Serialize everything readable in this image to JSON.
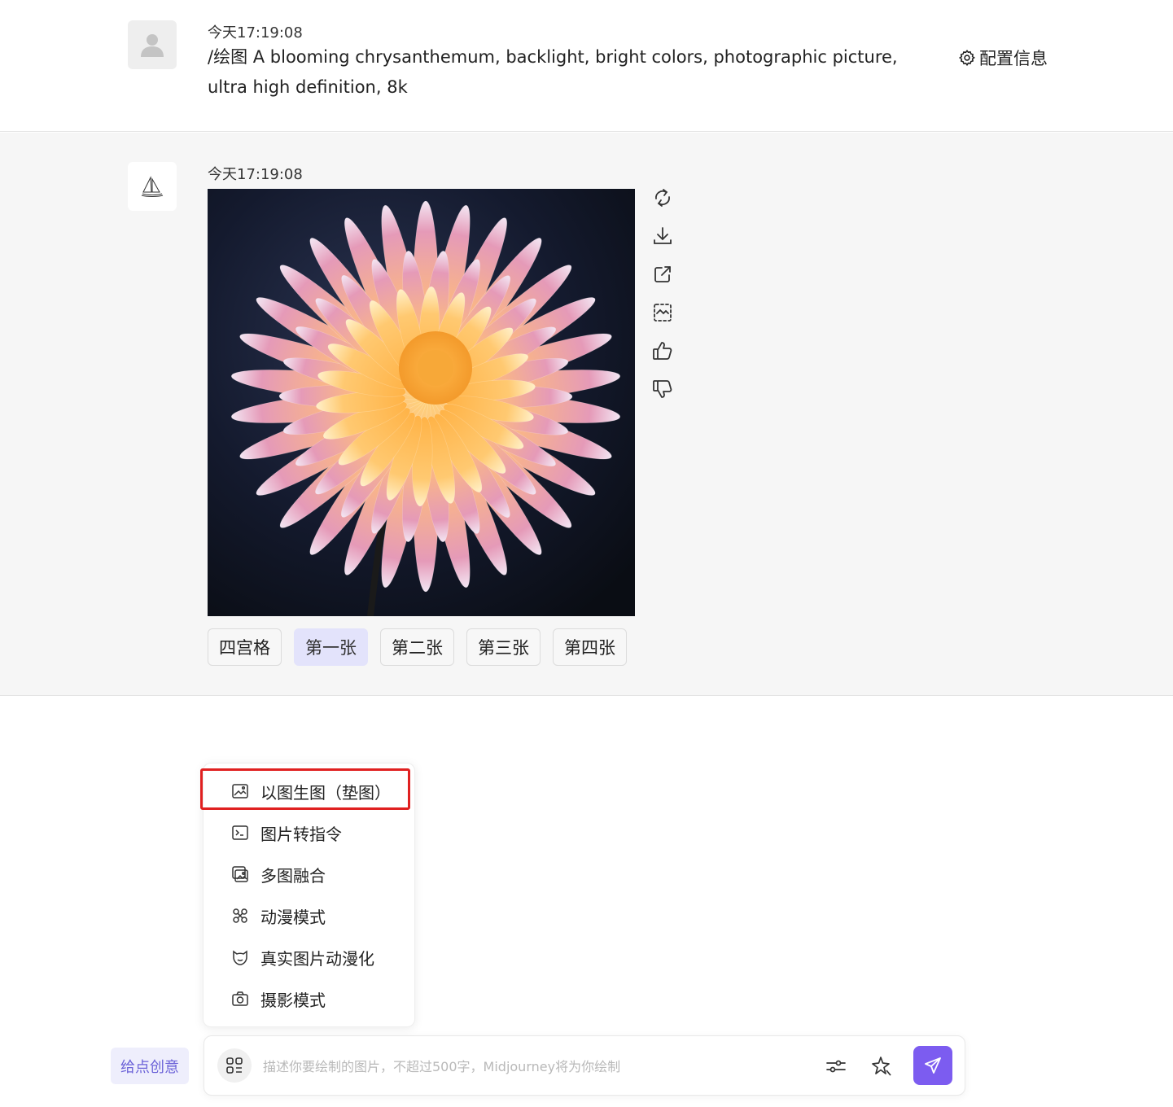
{
  "user_message": {
    "timestamp": "今天17:19:08",
    "prompt": "/绘图 A blooming chrysanthemum, backlight, bright colors, photographic picture, ultra high definition, 8k",
    "config_label": "配置信息"
  },
  "bot_message": {
    "timestamp": "今天17:19:08",
    "image_icon": "chrysanthemum-flower-image",
    "actions": [
      "refresh-icon",
      "download-icon",
      "share-icon",
      "image-detect-icon",
      "thumbs-up-icon",
      "thumbs-down-icon"
    ],
    "variants": [
      {
        "label": "四宫格",
        "active": false
      },
      {
        "label": "第一张",
        "active": true
      },
      {
        "label": "第二张",
        "active": false
      },
      {
        "label": "第三张",
        "active": false
      },
      {
        "label": "第四张",
        "active": false
      }
    ]
  },
  "mode_menu": {
    "items": [
      {
        "label": "以图生图（垫图）",
        "icon": "image-icon",
        "highlighted": true
      },
      {
        "label": "图片转指令",
        "icon": "terminal-icon"
      },
      {
        "label": "多图融合",
        "icon": "images-icon"
      },
      {
        "label": "动漫模式",
        "icon": "anime-icon"
      },
      {
        "label": "真实图片动漫化",
        "icon": "face-icon"
      },
      {
        "label": "摄影模式",
        "icon": "camera-icon"
      }
    ]
  },
  "composer": {
    "idea_button": "给点创意",
    "placeholder": "描述你要绘制的图片，不超过500字，Midjourney将为你绘制",
    "value": ""
  },
  "colors": {
    "accent": "#7c5cf0",
    "active_variant_bg": "#e3e3fb",
    "highlight_border": "#e02020",
    "idea_text": "#6c63d8"
  }
}
